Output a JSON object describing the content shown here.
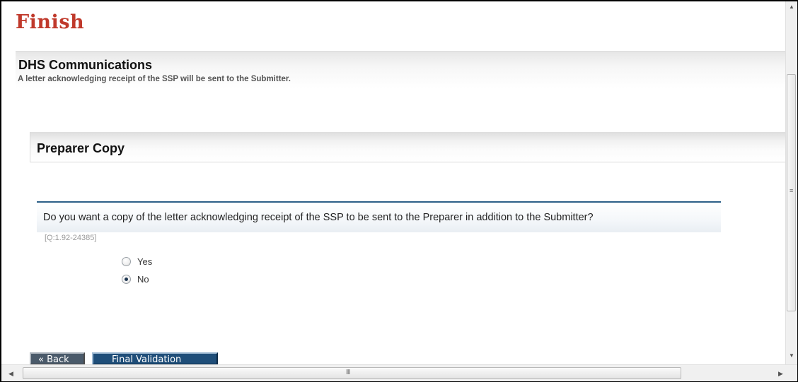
{
  "page": {
    "title": "Finish"
  },
  "dhs_section": {
    "heading": "DHS Communications",
    "text": "A letter acknowledging receipt of the SSP will be sent to the Submitter."
  },
  "preparer_section": {
    "heading": "Preparer Copy"
  },
  "question": {
    "text": "Do you want a copy of the letter acknowledging receipt of the SSP to be sent to the Preparer in addition to the Submitter?",
    "id": "[Q:1.92-24385]",
    "options": [
      {
        "label": "Yes",
        "selected": false
      },
      {
        "label": "No",
        "selected": true
      }
    ]
  },
  "buttons": {
    "back": "« Back",
    "final_validation": "Final Validation"
  },
  "scrollbars": {
    "up_arrow": "▲",
    "down_arrow": "▼",
    "left_arrow": "◀",
    "right_arrow": "▶",
    "v_grip": "≡",
    "h_grip": "III"
  }
}
